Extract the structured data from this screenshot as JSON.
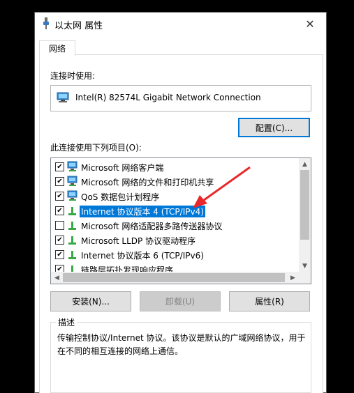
{
  "window": {
    "title": "以太网 属性",
    "close_glyph": "✕"
  },
  "tab": {
    "label": "网络"
  },
  "connect_using": {
    "label": "连接时使用:",
    "adapter_name": "Intel(R) 82574L Gigabit Network Connection",
    "configure_button": "配置(C)..."
  },
  "items_section": {
    "label": "此连接使用下列项目(O):",
    "items": [
      {
        "label": "Microsoft 网络客户端",
        "checked": true,
        "icon": "network-client-icon"
      },
      {
        "label": "Microsoft 网络的文件和打印机共享",
        "checked": true,
        "icon": "file-printer-sharing-icon"
      },
      {
        "label": "QoS 数据包计划程序",
        "checked": true,
        "icon": "qos-icon"
      },
      {
        "label": "Internet 协议版本 4 (TCP/IPv4)",
        "checked": true,
        "icon": "protocol-icon",
        "selected": true
      },
      {
        "label": "Microsoft 网络适配器多路传送器协议",
        "checked": false,
        "icon": "protocol-icon"
      },
      {
        "label": "Microsoft LLDP 协议驱动程序",
        "checked": true,
        "icon": "protocol-icon"
      },
      {
        "label": "Internet 协议版本 6 (TCP/IPv6)",
        "checked": true,
        "icon": "protocol-icon"
      },
      {
        "label": "链路层拓扑发现响应程序",
        "checked": true,
        "icon": "protocol-icon"
      }
    ]
  },
  "buttons": {
    "install": "安装(N)...",
    "uninstall": "卸载(U)",
    "properties": "属性(R)"
  },
  "description": {
    "title": "描述",
    "text": "传输控制协议/Internet 协议。该协议是默认的广域网络协议，用于在不同的相互连接的网络上通信。"
  },
  "colors": {
    "selection": "#0078d7",
    "annotation_arrow": "#e8282a"
  }
}
